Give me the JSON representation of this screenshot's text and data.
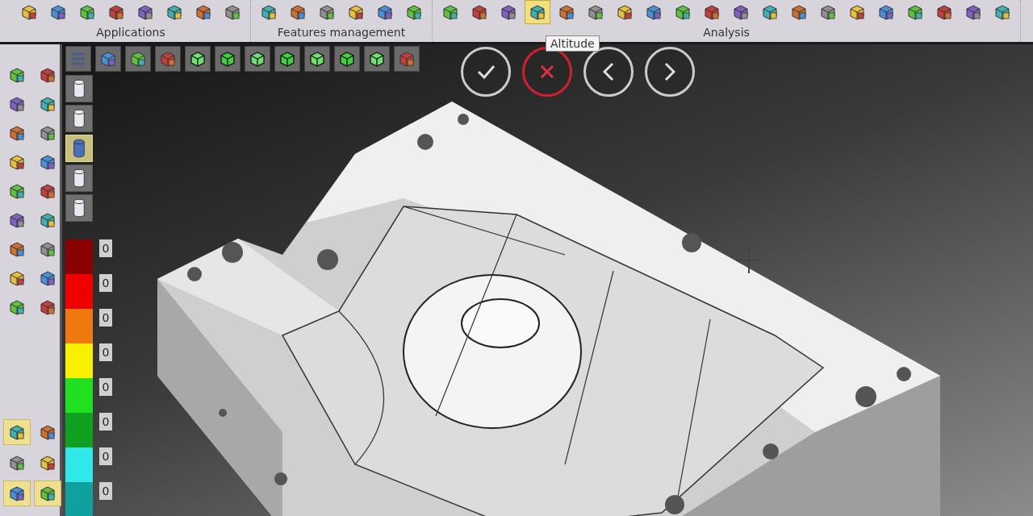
{
  "toolbar_groups": [
    {
      "label": "Applications",
      "icons": [
        {
          "selected": false
        },
        {
          "selected": false
        },
        {
          "selected": false
        },
        {
          "selected": false
        },
        {
          "selected": false
        },
        {
          "selected": false
        },
        {
          "selected": false
        },
        {
          "selected": false
        }
      ]
    },
    {
      "label": "Features management",
      "icons": [
        {
          "selected": false
        },
        {
          "selected": false
        },
        {
          "selected": false
        },
        {
          "selected": false
        },
        {
          "selected": false
        },
        {
          "selected": false
        }
      ]
    },
    {
      "label": "Analysis",
      "icons": [
        {
          "selected": false
        },
        {
          "selected": false
        },
        {
          "selected": false
        },
        {
          "selected": true
        },
        {
          "selected": false
        },
        {
          "selected": false
        },
        {
          "selected": false
        },
        {
          "selected": false
        },
        {
          "selected": false
        },
        {
          "selected": false
        },
        {
          "selected": false
        },
        {
          "selected": false
        },
        {
          "selected": false
        },
        {
          "selected": false
        },
        {
          "selected": false
        },
        {
          "selected": false
        },
        {
          "selected": false
        },
        {
          "selected": false
        },
        {
          "selected": false
        },
        {
          "selected": false
        }
      ]
    }
  ],
  "tooltip": {
    "text": "Altitude"
  },
  "view_toolbar": [
    {
      "selected": false
    },
    {
      "selected": false
    },
    {
      "selected": false
    },
    {
      "selected": false
    },
    {
      "selected": false
    },
    {
      "selected": false
    },
    {
      "selected": false
    },
    {
      "selected": false
    },
    {
      "selected": false
    },
    {
      "selected": false
    },
    {
      "selected": false
    },
    {
      "selected": false
    }
  ],
  "render_modes": [
    {
      "selected": false
    },
    {
      "selected": false
    },
    {
      "selected": true
    },
    {
      "selected": false
    },
    {
      "selected": false
    }
  ],
  "legend": [
    {
      "color": "#8b0000",
      "value": "0"
    },
    {
      "color": "#ee0000",
      "value": "0"
    },
    {
      "color": "#f07810",
      "value": "0"
    },
    {
      "color": "#f8f000",
      "value": "0"
    },
    {
      "color": "#20e020",
      "value": "0"
    },
    {
      "color": "#10a020",
      "value": "0"
    },
    {
      "color": "#30e8e8",
      "value": "0"
    },
    {
      "color": "#10a0a0",
      "value": "0"
    }
  ],
  "side_palette": {
    "icons": [
      {
        "selected": false
      },
      {
        "selected": false
      },
      {
        "selected": false
      },
      {
        "selected": false
      },
      {
        "selected": false
      },
      {
        "selected": false
      },
      {
        "selected": false
      },
      {
        "selected": false
      },
      {
        "selected": false
      },
      {
        "selected": false
      },
      {
        "selected": false
      },
      {
        "selected": false
      },
      {
        "selected": false
      },
      {
        "selected": false
      },
      {
        "selected": false
      },
      {
        "selected": false
      },
      {
        "selected": false
      },
      {
        "selected": false
      }
    ],
    "lower_icons": [
      {
        "selected": true
      },
      {
        "selected": false
      },
      {
        "selected": false
      },
      {
        "selected": false
      },
      {
        "selected": true
      },
      {
        "selected": true
      }
    ]
  },
  "actions": [
    {
      "kind": "confirm"
    },
    {
      "kind": "cancel"
    },
    {
      "kind": "previous"
    },
    {
      "kind": "next"
    }
  ]
}
